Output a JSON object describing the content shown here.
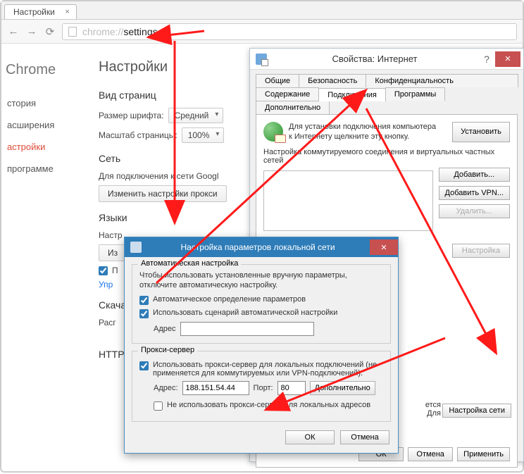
{
  "browser": {
    "tab_title": "Настройки",
    "url_proto": "chrome://",
    "url_path": "settings"
  },
  "sidebar": {
    "brand": "Chrome",
    "items": [
      "стория",
      "асширения",
      "астройки",
      "программе"
    ]
  },
  "settings": {
    "title": "Настройки",
    "sec_view": "Вид страниц",
    "font_label": "Размер шрифта:",
    "font_val": "Средний",
    "zoom_label": "Масштаб страницы:",
    "zoom_val": "100%",
    "sec_net": "Сеть",
    "net_desc": "Для подключения к сети Googl",
    "proxy_btn": "Изменить настройки прокси",
    "sec_lang": "Языки",
    "lang_desc": "Настр",
    "lang_btn": "Из",
    "tr_chk": "П",
    "tr_link": "Упр",
    "sec_dl": "Скача",
    "dl_label": "Расг",
    "sec_https": "HTTPS"
  },
  "inet": {
    "title": "Свойства: Интернет",
    "tabs1": [
      "Общие",
      "Безопасность",
      "Конфиденциальность"
    ],
    "tabs2": [
      "Содержание",
      "Подключения",
      "Программы",
      "Дополнительно"
    ],
    "active_tab": "Подключения",
    "conn_text1": "Для установки подключения компьютера",
    "conn_text2": "к Интернету щелкните эту кнопку.",
    "install_btn": "Установить",
    "dial_label": "Настройка коммутируемого соединения и виртуальных частных сетей",
    "add_btn": "Добавить...",
    "add_vpn_btn": "Добавить VPN...",
    "del_btn": "Удалить...",
    "cfg_btn": "Настройка",
    "lan_text1": "ется",
    "lan_text2": "Для",
    "lan_settings_btn": "Настройка сети",
    "ok": "ОК",
    "cancel": "Отмена",
    "apply": "Применить"
  },
  "lan": {
    "title": "Настройка параметров локальной сети",
    "fs1": "Автоматическая настройка",
    "fs1_text": "Чтобы использовать установленные вручную параметры, отключите автоматическую настройку.",
    "auto_detect": "Автоматическое определение параметров",
    "auto_script": "Использовать сценарий автоматической настройки",
    "addr_label": "Адрес",
    "script_addr": "",
    "fs2": "Прокси-сервер",
    "proxy_use": "Использовать прокси-сервер для локальных подключений (не применяется для коммутируемых или VPN-подключений).",
    "addr2_label": "Адрес:",
    "proxy_addr": "188.151.54.44",
    "port_label": "Порт:",
    "proxy_port": "80",
    "adv_btn": "Дополнительно",
    "bypass": "Не использовать прокси-сервер для локальных адресов",
    "ok": "ОК",
    "cancel": "Отмена"
  }
}
